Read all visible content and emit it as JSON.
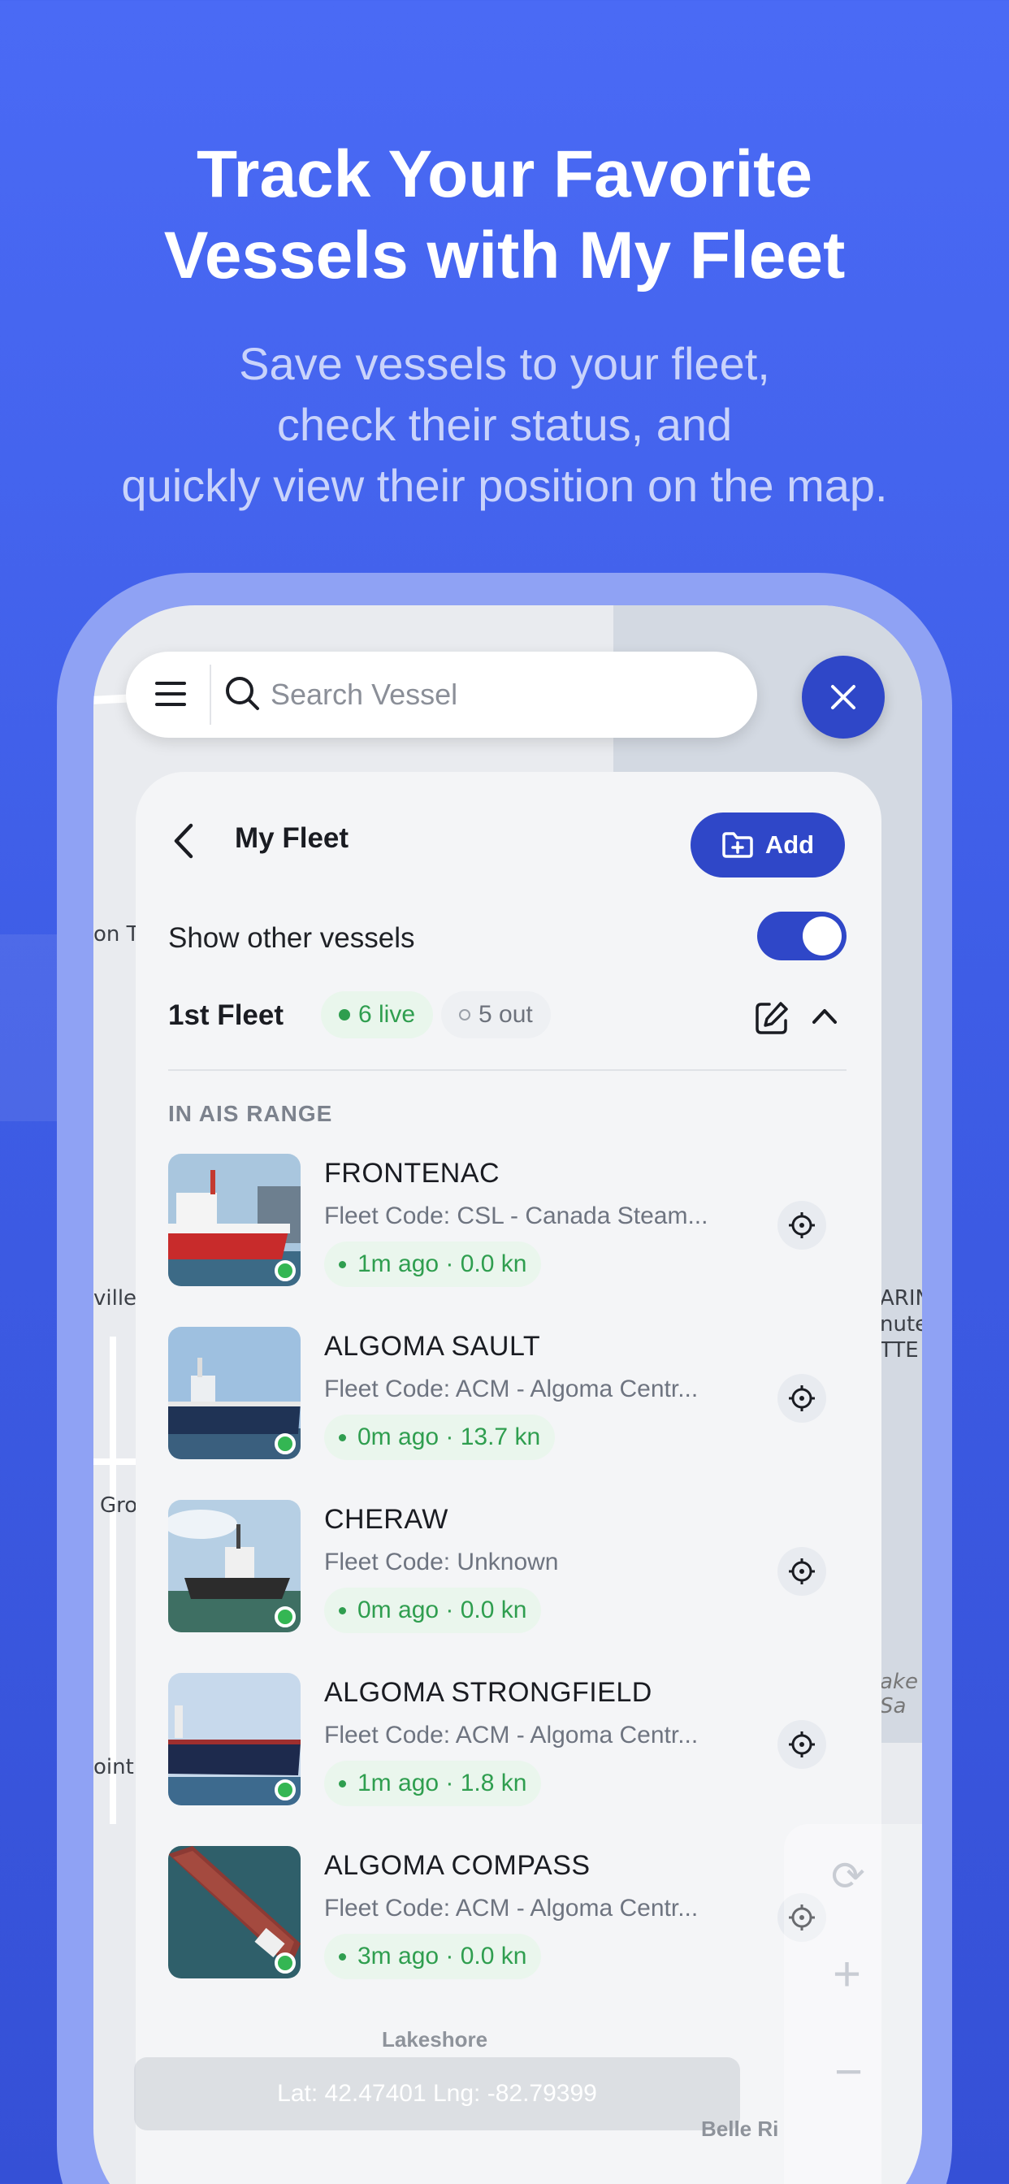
{
  "hero": {
    "title_line1": "Track Your Favorite",
    "title_line2": "Vessels with My Fleet",
    "subtitle_line1": "Save vessels to your fleet,",
    "subtitle_line2": "check their status, and",
    "subtitle_line3": "quickly view their position on the map."
  },
  "search": {
    "placeholder": "Search Vessel"
  },
  "panel": {
    "title": "My Fleet",
    "add_label": "Add",
    "show_other_label": "Show other vessels",
    "show_other_enabled": true,
    "fleet_name": "1st Fleet",
    "live_label": "6 live",
    "out_label": "5 out",
    "section_label": "IN AIS RANGE"
  },
  "vessels": [
    {
      "name": "FRONTENAC",
      "code": "Fleet Code: CSL - Canada Steam...",
      "status": "1m ago · 0.0 kn"
    },
    {
      "name": "ALGOMA SAULT",
      "code": "Fleet Code: ACM - Algoma Centr...",
      "status": "0m ago · 13.7 kn"
    },
    {
      "name": "CHERAW",
      "code": "Fleet Code: Unknown",
      "status": "0m ago · 0.0 kn"
    },
    {
      "name": "ALGOMA STRONGFIELD",
      "code": "Fleet Code: ACM - Algoma Centr...",
      "status": "1m ago · 1.8 kn"
    },
    {
      "name": "ALGOMA COMPASS",
      "code": "Fleet Code: ACM - Algoma Centr...",
      "status": "3m ago · 0.0 kn"
    }
  ],
  "map": {
    "labels": [
      "on T",
      "ville",
      "Gro",
      "oint",
      "ARIN",
      "nute",
      "TTE",
      "ake Sa"
    ],
    "coords": "Lat: 42.47401 Lng: -82.79399",
    "bottom_label_1": "Lakeshore",
    "bottom_label_2": "Belle Ri"
  },
  "colors": {
    "primary": "#2f47c8",
    "live_green": "#2f9e4f",
    "background_top": "#4a6af5"
  }
}
